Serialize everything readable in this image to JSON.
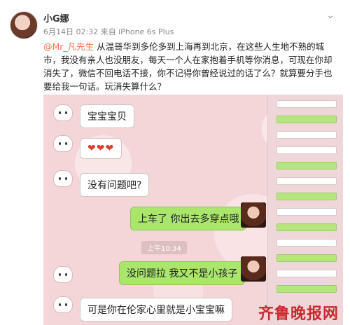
{
  "post": {
    "username": "小G娜",
    "meta": "6月14日 02:32 来自 iPhone 6s Plus",
    "mention": "@Mr_凡先生",
    "body": " 从温哥华到多伦多到上海再到北京，在这些人生地不熟的城市，我没有亲人也没朋友，每天一个人在家抱着手机等你消息，可现在你却消失了，微信不回电话不接，你不记得你曾经说过的话了么？就算要分手也要给我一句话。玩消失算什么？"
  },
  "chat": {
    "msg1": "宝宝宝贝",
    "msg2": "❤❤❤",
    "msg3": "没有问题吧?",
    "msg4": "上车了 你出去多穿点哦",
    "timestamp": "上午10:34",
    "msg5": "没问题拉 我又不是小孩子",
    "msg6": "可是你在伦家心里就是小宝宝嘛"
  },
  "watermark": "齐鲁晚报网"
}
